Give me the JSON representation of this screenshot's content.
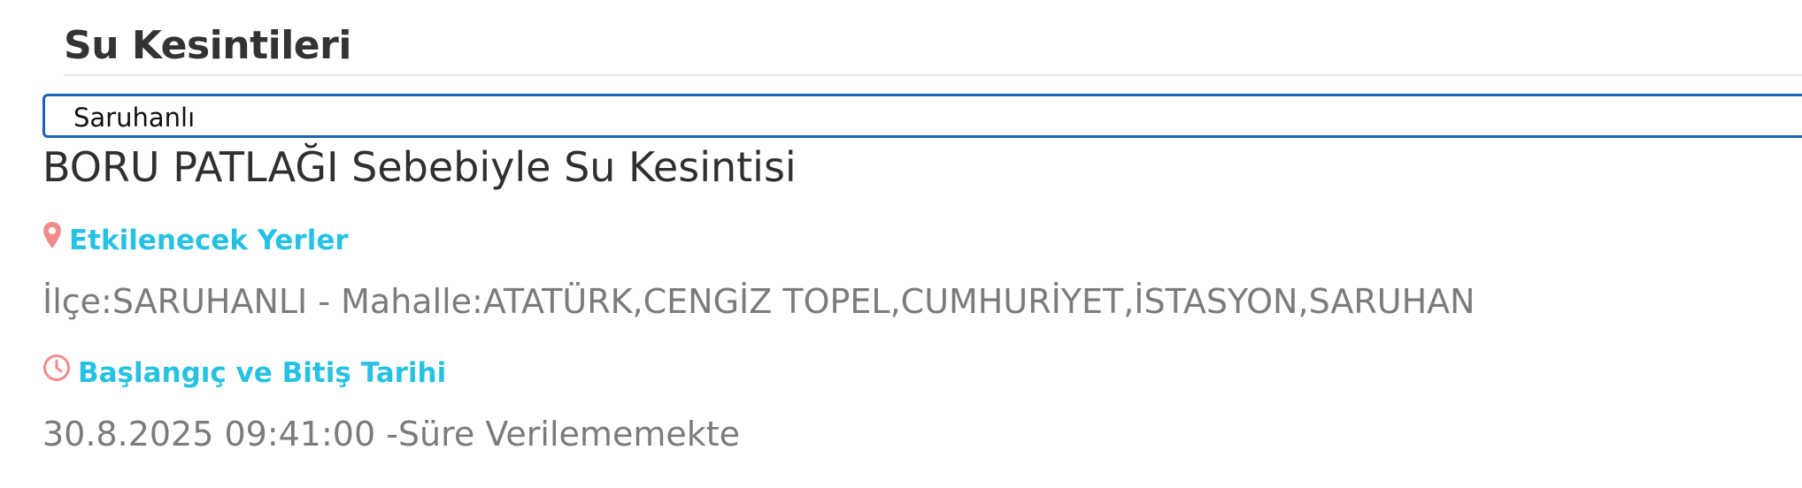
{
  "page": {
    "title": "Su Kesintileri"
  },
  "district_select": {
    "selected": "Saruhanlı"
  },
  "outage": {
    "title": "BORU PATLAĞI Sebebiyle Su Kesintisi",
    "places_heading": "Etkilenecek Yerler",
    "places_icon": "map-pin-icon",
    "places_value": "İlçe:SARUHANLI - Mahalle:ATATÜRK,CENGİZ TOPEL,CUMHURİYET,İSTASYON,SARUHAN",
    "dates_heading": "Başlangıç ve Bitiş Tarihi",
    "dates_icon": "clock-icon",
    "dates_value": "30.8.2025 09:41:00 -Süre Verilememekte"
  },
  "colors": {
    "heading_accent": "#27c2e3",
    "icon_accent": "#f28b8b",
    "select_border": "#1b63b8",
    "body_text": "#7b7b7b",
    "title_text": "#333333"
  }
}
